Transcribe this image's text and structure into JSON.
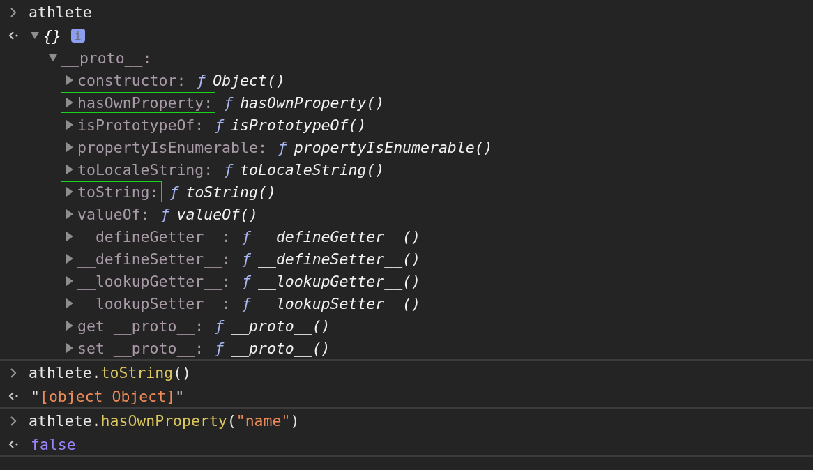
{
  "groups": [
    {
      "entries": [
        {
          "kind": "input",
          "tokens": [
            {
              "text": "athlete",
              "kind": "plain"
            }
          ]
        },
        {
          "kind": "object",
          "preview": "{}",
          "expanded": true,
          "info_badge": "i",
          "children": [
            {
              "key": "__proto__:",
              "expanded": true,
              "highlighted": false,
              "children": [
                {
                  "key": "constructor:",
                  "marker": "ƒ",
                  "value": "Object()",
                  "expanded": false,
                  "highlighted": false
                },
                {
                  "key": "hasOwnProperty:",
                  "marker": "ƒ",
                  "value": "hasOwnProperty()",
                  "expanded": false,
                  "highlighted": true
                },
                {
                  "key": "isPrototypeOf:",
                  "marker": "ƒ",
                  "value": "isPrototypeOf()",
                  "expanded": false,
                  "highlighted": false
                },
                {
                  "key": "propertyIsEnumerable:",
                  "marker": "ƒ",
                  "value": "propertyIsEnumerable()",
                  "expanded": false,
                  "highlighted": false
                },
                {
                  "key": "toLocaleString:",
                  "marker": "ƒ",
                  "value": "toLocaleString()",
                  "expanded": false,
                  "highlighted": false
                },
                {
                  "key": "toString:",
                  "marker": "ƒ",
                  "value": "toString()",
                  "expanded": false,
                  "highlighted": true
                },
                {
                  "key": "valueOf:",
                  "marker": "ƒ",
                  "value": "valueOf()",
                  "expanded": false,
                  "highlighted": false
                },
                {
                  "key": "__defineGetter__:",
                  "marker": "ƒ",
                  "value": "__defineGetter__()",
                  "expanded": false,
                  "highlighted": false
                },
                {
                  "key": "__defineSetter__:",
                  "marker": "ƒ",
                  "value": "__defineSetter__()",
                  "expanded": false,
                  "highlighted": false
                },
                {
                  "key": "__lookupGetter__:",
                  "marker": "ƒ",
                  "value": "__lookupGetter__()",
                  "expanded": false,
                  "highlighted": false
                },
                {
                  "key": "__lookupSetter__:",
                  "marker": "ƒ",
                  "value": "__lookupSetter__()",
                  "expanded": false,
                  "highlighted": false
                },
                {
                  "key": "get __proto__:",
                  "marker": "ƒ",
                  "value": "__proto__()",
                  "expanded": false,
                  "highlighted": false
                },
                {
                  "key": "set __proto__:",
                  "marker": "ƒ",
                  "value": "__proto__()",
                  "expanded": false,
                  "highlighted": false
                }
              ]
            }
          ]
        }
      ]
    },
    {
      "entries": [
        {
          "kind": "input",
          "tokens": [
            {
              "text": "athlete.",
              "kind": "plain"
            },
            {
              "text": "toString",
              "kind": "method"
            },
            {
              "text": "()",
              "kind": "plain"
            }
          ]
        },
        {
          "kind": "result",
          "tokens": [
            {
              "text": "\"",
              "kind": "plain"
            },
            {
              "text": "[object Object]",
              "kind": "string"
            },
            {
              "text": "\"",
              "kind": "plain"
            }
          ]
        }
      ]
    },
    {
      "entries": [
        {
          "kind": "input",
          "tokens": [
            {
              "text": "athlete.",
              "kind": "plain"
            },
            {
              "text": "hasOwnProperty",
              "kind": "method"
            },
            {
              "text": "(",
              "kind": "plain"
            },
            {
              "text": "\"name\"",
              "kind": "string"
            },
            {
              "text": ")",
              "kind": "plain"
            }
          ]
        },
        {
          "kind": "result",
          "tokens": [
            {
              "text": "false",
              "kind": "boolean"
            }
          ]
        }
      ]
    }
  ]
}
